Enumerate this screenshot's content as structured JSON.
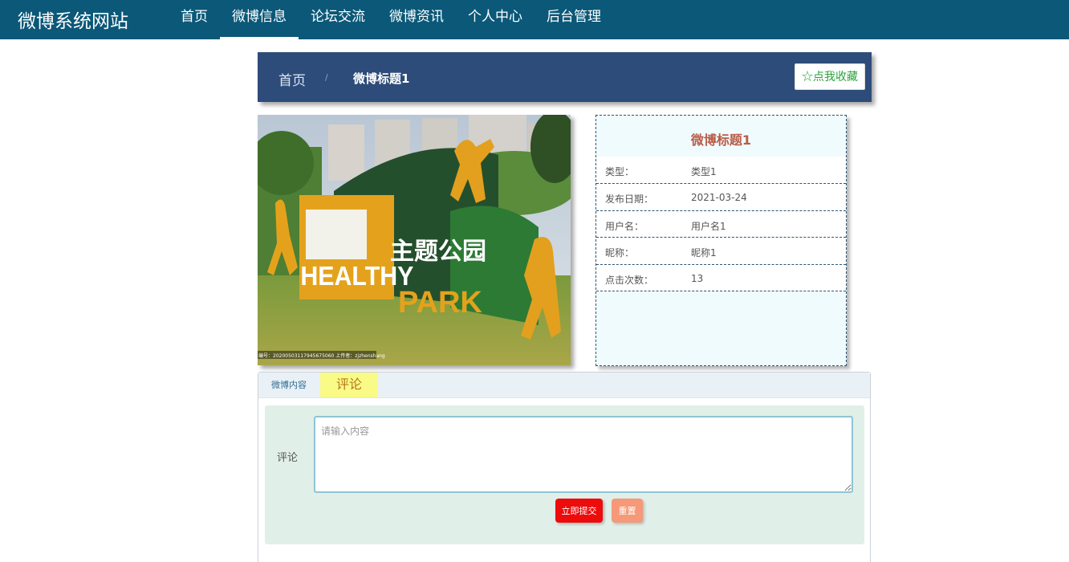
{
  "brand": "微博系统网站",
  "nav": {
    "items": [
      {
        "label": "首页",
        "active": false
      },
      {
        "label": "微博信息",
        "active": true
      },
      {
        "label": "论坛交流",
        "active": false
      },
      {
        "label": "微博资讯",
        "active": false
      },
      {
        "label": "个人中心",
        "active": false
      },
      {
        "label": "后台管理",
        "active": false
      }
    ]
  },
  "breadcrumb": {
    "home": "首页",
    "separator": "/",
    "current": "微博标题1"
  },
  "favorite_button": "☆点我收藏",
  "photo": {
    "sign_line1": "HEALTHY",
    "sign_line2": "PARK",
    "sign_cn": "主题公园",
    "watermark": "编号：20200503117945675060  上传者：zjzhenshang"
  },
  "info": {
    "title": "微博标题1",
    "rows": [
      {
        "label": "类型：",
        "value": "类型1"
      },
      {
        "label": "发布日期：",
        "value": "2021-03-24"
      },
      {
        "label": "用户名：",
        "value": "用户名1"
      },
      {
        "label": "昵称：",
        "value": "昵称1"
      },
      {
        "label": "点击次数：",
        "value": "13"
      }
    ]
  },
  "tabs": [
    {
      "label": "微博内容",
      "active": false
    },
    {
      "label": "评论",
      "active": true
    }
  ],
  "comment_form": {
    "label": "评论",
    "placeholder": "请输入内容",
    "submit_label": "立即提交",
    "reset_label": "重置"
  },
  "colors": {
    "nav_bg": "#0b5878",
    "breadcrumb_bg": "#2d4c7a",
    "info_title": "#b95c48",
    "submit": "#ee0b0b",
    "reset": "#f59978",
    "active_tab": "#fafa87"
  }
}
